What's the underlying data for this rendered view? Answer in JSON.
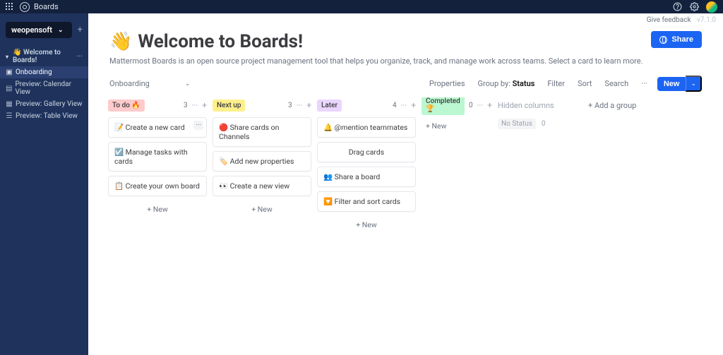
{
  "topbar": {
    "title": "Boards"
  },
  "workspace": {
    "name": "weopensoft"
  },
  "sidebar": {
    "board_label": "👋 Welcome to Boards!",
    "views": [
      "Onboarding",
      "Preview: Calendar View",
      "Preview: Gallery View",
      "Preview: Table View"
    ]
  },
  "meta": {
    "feedback": "Give feedback",
    "version": "v7.1.0"
  },
  "page": {
    "emoji": "👋",
    "title": "Welcome to Boards!",
    "description": "Mattermost Boards is an open source project management tool that helps you organize, track, and manage work across teams. Select a card to learn more.",
    "share": "Share"
  },
  "toolbar": {
    "view": "Onboarding",
    "properties": "Properties",
    "group_by_label": "Group by:",
    "group_by_value": "Status",
    "filter": "Filter",
    "sort": "Sort",
    "search": "Search",
    "more": "···",
    "new": "New"
  },
  "columns": [
    {
      "id": "todo",
      "label": "To do 🔥",
      "pill": "pill-red",
      "count": 3,
      "cards": [
        "📝 Create a new card",
        "☑️ Manage tasks with cards",
        "📋 Create your own board"
      ],
      "new": "+ New"
    },
    {
      "id": "nextup",
      "label": "Next up",
      "pill": "pill-yellow",
      "count": 3,
      "cards": [
        "🔴 Share cards on Channels",
        "🏷️ Add new properties",
        "👀 Create a new view"
      ],
      "new": "+ New"
    },
    {
      "id": "later",
      "label": "Later",
      "pill": "pill-purple",
      "count": 4,
      "cards": [
        "🔔 @mention teammates",
        "Drag cards",
        "👥 Share a board",
        "🔽 Filter and sort cards"
      ],
      "new": "+ New"
    },
    {
      "id": "completed",
      "label": "Completed 🏆",
      "pill": "pill-green",
      "count": 0,
      "cards": [],
      "new": "+ New"
    }
  ],
  "hidden": {
    "header": "Hidden columns",
    "nostatus": "No Status",
    "count": 0
  },
  "add_group": "+ Add a group"
}
